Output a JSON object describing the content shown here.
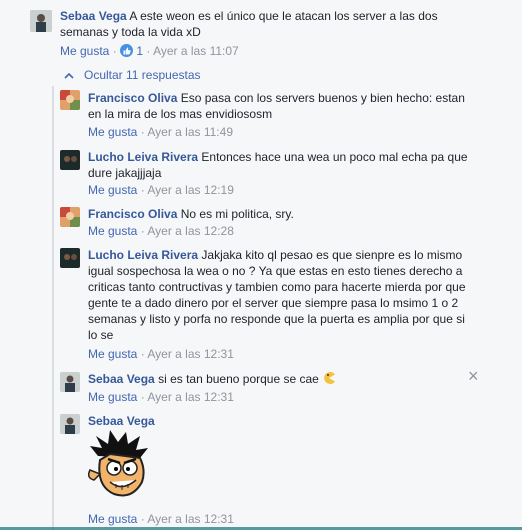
{
  "main": {
    "top": {
      "author": "Sebaa Vega",
      "text": "A este weon es el único que le atacan los server a las dos semanas y toda la vida xD",
      "like": "Me gusta",
      "reactions": "1",
      "time": "Ayer a las 11:07"
    },
    "toggle": "Ocultar 11 respuestas",
    "replies": [
      {
        "author": "Francisco Oliva",
        "text": "Eso pasa con los servers buenos y bien hecho: estan en la mira de los mas envidiososm",
        "like": "Me gusta",
        "time": "Ayer a las 11:49"
      },
      {
        "author": "Lucho Leiva Rivera",
        "text": "Entonces hace una wea un poco mal echa pa que dure jakajjjaja",
        "like": "Me gusta",
        "time": "Ayer a las 12:19"
      },
      {
        "author": "Francisco Oliva",
        "text": "No es mi politica, sry.",
        "like": "Me gusta",
        "time": "Ayer a las 12:28"
      },
      {
        "author": "Lucho Leiva Rivera",
        "text": "Jakjaka kito ql pesao es que sienpre es lo mismo igual sospechosa la wea o no ? Ya que estas en esto tienes derecho a criticas tanto contructivas y tambien como para hacerte mierda por que gente te a dado dinero por el server que siempre pasa lo msimo 1 o 2 semanas y listo y porfa no responde que la puerta es amplia por que si lo se",
        "like": "Me gusta",
        "time": "Ayer a las 12:31"
      },
      {
        "author": "Sebaa Vega",
        "text": "si es tan bueno porque se cae",
        "like": "Me gusta",
        "time": "Ayer a las 12:31"
      },
      {
        "author": "Sebaa Vega",
        "text": "",
        "like": "Me gusta",
        "time": "Ayer a las 12:31"
      }
    ],
    "dot": "·",
    "close": "×"
  }
}
